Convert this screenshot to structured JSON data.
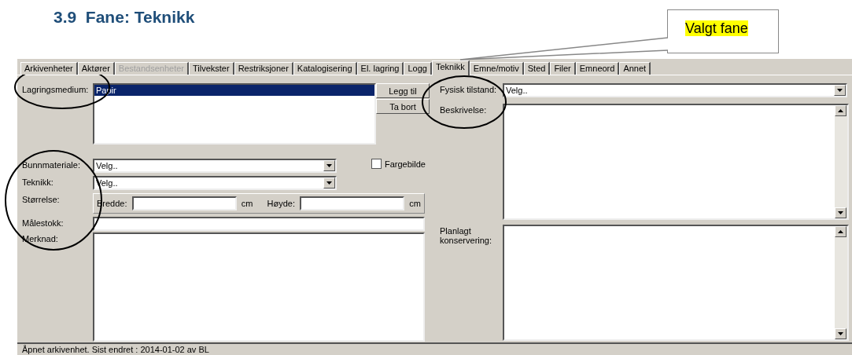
{
  "heading": "3.9  Fane: Teknikk",
  "callout": {
    "text": "Valgt fane"
  },
  "tabs": [
    {
      "label": "Arkivenheter",
      "selected": false,
      "disabled": false
    },
    {
      "label": "Aktører",
      "selected": false,
      "disabled": false
    },
    {
      "label": "Bestandsenheter",
      "selected": false,
      "disabled": true
    },
    {
      "label": "Tilvekster",
      "selected": false,
      "disabled": false
    },
    {
      "label": "Restriksjoner",
      "selected": false,
      "disabled": false
    },
    {
      "label": "Katalogisering",
      "selected": false,
      "disabled": false
    },
    {
      "label": "El. lagring",
      "selected": false,
      "disabled": false
    },
    {
      "label": "Logg",
      "selected": false,
      "disabled": false
    },
    {
      "label": "Teknikk",
      "selected": true,
      "disabled": false
    },
    {
      "label": "Emne/motiv",
      "selected": false,
      "disabled": false
    },
    {
      "label": "Sted",
      "selected": false,
      "disabled": false
    },
    {
      "label": "Filer",
      "selected": false,
      "disabled": false
    },
    {
      "label": "Emneord",
      "selected": false,
      "disabled": false
    },
    {
      "label": "Annet",
      "selected": false,
      "disabled": false
    }
  ],
  "storage": {
    "label": "Lagringsmedium:",
    "items": [
      {
        "text": "Papir",
        "selected": true
      }
    ],
    "buttons": [
      "Legg til",
      "Ta bort"
    ]
  },
  "color_image": {
    "label": "Fargebilde",
    "checked": false
  },
  "left_fields": [
    {
      "kind": "combo",
      "label": "Bunnmateriale:",
      "value": "Velg.."
    },
    {
      "kind": "combo",
      "label": "Teknikk:",
      "value": "Velg.."
    },
    {
      "kind": "size",
      "label": "Størrelse:",
      "width_label": "Bredde:",
      "width_unit": "cm",
      "height_label": "Høyde:",
      "height_unit": "cm"
    },
    {
      "kind": "text",
      "label": "Målestokk:"
    },
    {
      "kind": "textarea",
      "label": "Merknad:"
    }
  ],
  "right_fields": [
    {
      "kind": "combo",
      "label": "Fysisk tilstand:",
      "value": "Velg.."
    },
    {
      "kind": "scrollarea",
      "label": "Beskrivelse:"
    },
    {
      "kind": "scrollarea",
      "label": "Planlagt konservering:"
    }
  ],
  "status_bar": "Åpnet arkivenhet. Sist endret : 2014-01-02 av BL"
}
